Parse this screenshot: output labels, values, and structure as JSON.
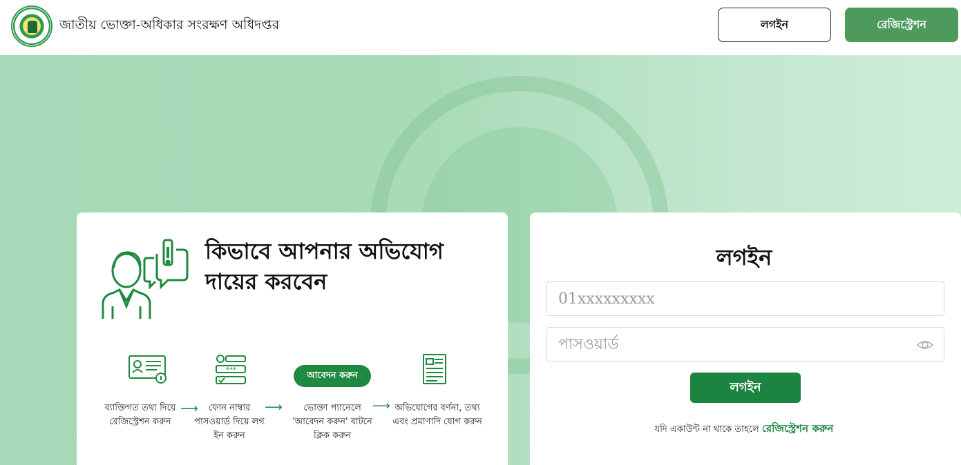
{
  "header": {
    "site_title": "জাতীয় ভোক্তা-অধিকার সংরক্ষণ অধিদপ্তর",
    "login_label": "লগইন",
    "register_label": "রেজিস্ট্রেশন"
  },
  "how_to": {
    "title_line1": "কিভাবে আপনার অভিযোগ",
    "title_line2": "দায়ের করবেন",
    "apply_button": "আবেদন করুন",
    "steps": [
      {
        "line1": "ব্যাক্তিগত তথ্য দিয়ে",
        "line2": "রেজিস্ট্রেশন করুন",
        "line3": ""
      },
      {
        "line1": "ফোন নাম্বার",
        "line2": "পাসওয়ার্ড দিয়ে লগ",
        "line3": "ইন করুন"
      },
      {
        "line1": "ভোক্তা প্যানেলে",
        "line2": "'আবেদন করুন' বাটনে",
        "line3": "ক্লিক করুন"
      },
      {
        "line1": "অভিযোগের বর্ণনা, তথ্য",
        "line2": "এবং প্রমাণাদি যোগ করুন",
        "line3": ""
      }
    ]
  },
  "login_form": {
    "heading": "লগইন",
    "phone_placeholder": "01xxxxxxxxx",
    "password_placeholder": "পাসওয়ার্ড",
    "submit_label": "লগইন",
    "no_account_text": "যদি একাউন্ট না থাকে তাহলে",
    "register_link": "রেজিস্ট্রেশন করুন"
  },
  "colors": {
    "brand_green": "#1b8440",
    "register_button": "#4e9a5c",
    "hero_bg": "#a9dbb8"
  }
}
